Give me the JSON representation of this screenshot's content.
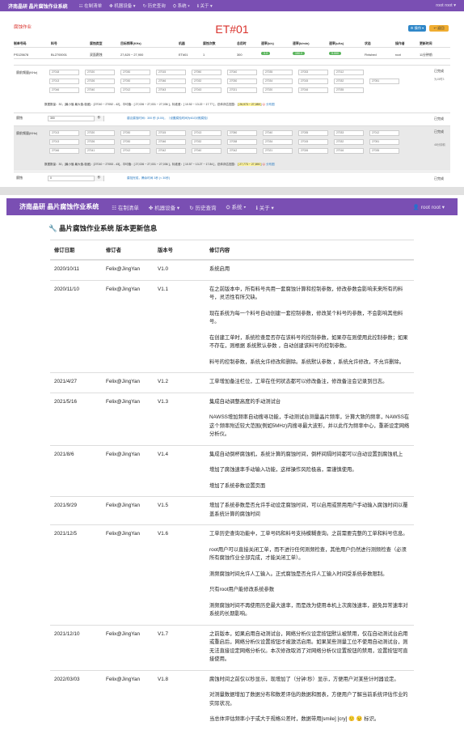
{
  "nav": {
    "brand": "济南晶研 晶片腐蚀作业系统",
    "items": [
      "☷ 在制清单",
      "✤ 机器设备 ▾",
      "↻ 历史查询",
      "⛭ 系统 ▾",
      "ℹ 关于 ▾"
    ],
    "user": "root root ▾"
  },
  "page": {
    "subtitle": "腐蚀作业",
    "title": "ET#01",
    "op_button": "⚙ 操作 ▾",
    "back_button": "↩ 返回"
  },
  "work_table": {
    "headers": [
      "制单号码",
      "料号",
      "腐蚀类型",
      "目标频率(KHz)",
      "机器",
      "腐蚀次数",
      "总用时",
      "速率(k/s)",
      "速率(k/min)",
      "速率(u/ks)",
      "状态",
      "操作者",
      "更新时间"
    ],
    "row": [
      "PS125678",
      "BL2700001",
      "双面腐蚀",
      "27,820 ~ 27,900",
      "ET#01",
      "1",
      "300",
      "3.3",
      "150.0",
      "5.000",
      "Finished",
      "root",
      "11分钟前"
    ]
  },
  "blocks": [
    {
      "label": "腐前频量(KHz)",
      "status": "已完成",
      "status2": "为15时3",
      "values": [
        [
          "27018",
          "27020",
          "27030",
          "27015",
          "27050",
          "27040",
          "27035",
          "27033",
          "27012"
        ],
        [
          "27013",
          "27026",
          "27030",
          "27046",
          "27032",
          "27030",
          "27034",
          "27015",
          "27032",
          "27051"
        ],
        [
          "27046",
          "27040",
          "27012",
          "27043",
          "27043",
          "27021",
          "27020",
          "27016",
          "27035"
        ]
      ],
      "stats": "数据数量：30，[最小值-最大值-极差]：[27010 ~ 27052 - 42]，平均值：[ 27,026 ~ 27,031 ~ 27,036 ]，标准差：[ 10.52 ~ 13.22 ~ 17.77 ]，总体评估范围：",
      "range": "[ 26,973 ~ 27,089 ]",
      "dist": "分布图"
    },
    {
      "label": "腐蚀",
      "status": "已完成",
      "input": "300",
      "unit": "秒",
      "note": "建议腐蚀时间：300 秒 (5.00)，（设置腐蚀时间为60J对照腐蚀）"
    },
    {
      "label": "腐前频量(KHz)",
      "status": "已完成",
      "status2": "48分钟前",
      "values": [
        [
          "27013",
          "27020",
          "27030",
          "27015",
          "27013",
          "27050",
          "27040",
          "27035",
          "27033",
          "27012"
        ],
        [
          "27013",
          "27026",
          "27030",
          "27046",
          "27032",
          "27038",
          "27034",
          "27015",
          "27032",
          "27051"
        ],
        [
          "27046",
          "27041",
          "27012",
          "27042",
          "27040",
          "27042",
          "27021",
          "27026",
          "27016",
          "27035"
        ]
      ],
      "stats": "数据数量：30，[最小值-最大值-极差]：[27010 ~ 27053 - 43]，平均值：[ 27,026 ~ 27,031 ~ 27,036 ]，标准差：[ 10.57 ~ 13.27 ~ 17.84 ]，总体评估范围：",
      "range": "[ 27,773 ~ 27,890 ]",
      "dist": "分布图"
    },
    {
      "label": "腐蚀",
      "status": "已完成",
      "input": "0",
      "unit": "秒",
      "note": "腐蚀完成，腾余时间 3秒 (< 30秒)"
    }
  ],
  "second_nav": {
    "brand": "济南晶研 晶片腐蚀作业系统",
    "items": [
      "☷ 在制清单",
      "✤ 机器设备 ▾",
      "↻ 历史查询",
      "⛭ 系统 ▾",
      "ℹ 关于 ▾"
    ],
    "user": "👤 root root ▾"
  },
  "versions": {
    "title": "🔧 晶片腐蚀作业系统 版本更新信息",
    "headers": [
      "修订日期",
      "修订者",
      "版本号",
      "修订内容"
    ],
    "rows": [
      {
        "date": "2020/10/11",
        "author": "Felix@JingYan",
        "ver": "V1.0",
        "content": [
          "系统启用"
        ]
      },
      {
        "date": "2020/11/10",
        "author": "Felix@JingYan",
        "ver": "V1.1",
        "content": [
          "在之前版本中，所有料号共用一套腐蚀计算和控制参数，修改参数会影响未来所有的料号，灵活性有所欠缺。",
          "现在系统为每一个料号自动创建一套控制参数，修改某个料号的参数，不会影响其他料号。",
          "在创建工单时，系统检查是否存在该料号的控制参数，如果存在则使用此控制参数；如果不存在，则根据 系统默认参数 ，自动创建该料号的控制参数。",
          "料号的控制参数，系统允许修改和删除。系统默认参数 ，系统允许修改，不允许删除。"
        ]
      },
      {
        "date": "2021/4/27",
        "author": "Felix@JingYan",
        "ver": "V1.2",
        "content": [
          "工单增加备注栏位，工单在任何状态都可以修改备注，修改备注会记录到日志。"
        ]
      },
      {
        "date": "2021/5/16",
        "author": "Felix@JingYan",
        "ver": "V1.3",
        "content": [
          "集成自动调整高度的手动测试台",
          "NAWSS增加频率自动搜寻功能，手动测试台测量晶片频率，计算大致的频率，NAWSS在这个频率附近较大范围(例如5MHz)内搜寻最大波形，并以此作为频率中心，重新设定网络分析仪。"
        ]
      },
      {
        "date": "2021/8/6",
        "author": "Felix@JingYan",
        "ver": "V1.4",
        "content": [
          "集成自动倒杯腐蚀机，系统计算的腐蚀时间，倒杯间隔时间都可以自动设置到腐蚀机上",
          "增加了腐蚀速率手动输入功能，这样操作风险极高，需谨慎使用。",
          "增加了系统参数设置页面"
        ]
      },
      {
        "date": "2021/9/29",
        "author": "Felix@JingYan",
        "ver": "V1.5",
        "content": [
          "增加了系统参数是否允许手动设定腐蚀时间，可以启用或禁用用户手动输入腐蚀时间以覆盖系统计算的腐蚀时间"
        ]
      },
      {
        "date": "2021/12/5",
        "author": "Felix@JingYan",
        "ver": "V1.6",
        "content": [
          "工单历史查询功能中，工单号码和料号支持模糊查询。之前需要完整的工单和料号信息。",
          "root用户可以直接关闭工单，而不进行任何测频检查，其他用户仍然进行测频检查（必须所有腐蚀作业全部完成，才能关闭工单）。",
          "测频腐蚀时间允许人工输入。正式腐蚀是否允许人工输入时间受系统参数限制。",
          "只有root用户能修改系统参数",
          "测频腐蚀时间不再使用历史最大速率，而是改为使用本机上次腐蚀速率，避免异常速率对系统的长期影响。"
        ]
      },
      {
        "date": "2021/12/10",
        "author": "Felix@JingYan",
        "ver": "V1.7",
        "content": [
          "之前版本，如果启用自动测试台，网络分析仪设定按钮默认被禁用，仅在自动测试台启用或重启后，网络分析仪设置按钮才被激活启用。如果某些测量工位不使用自动测试台，则无法直接设定网络分析仪。本次修改取消了对网络分析仪设置按钮的禁用，设置按钮可直接使用。"
        ]
      },
      {
        "date": "2022/03/03",
        "author": "Felix@JingYan",
        "ver": "V1.8",
        "content": [
          "腐蚀时间之前仅以秒显示，现增加了（分钟:秒）显示，方便用户对某些计时器设定。",
          "对测量数据增加了数据分布和数差评估的数据和图表，方便用户了解当前系统评估作业的实际状况。",
          "当总体评估频率小于或大于规格公差时，数据带用[smile] [cry] 🙂 😟 标识。"
        ]
      }
    ]
  }
}
